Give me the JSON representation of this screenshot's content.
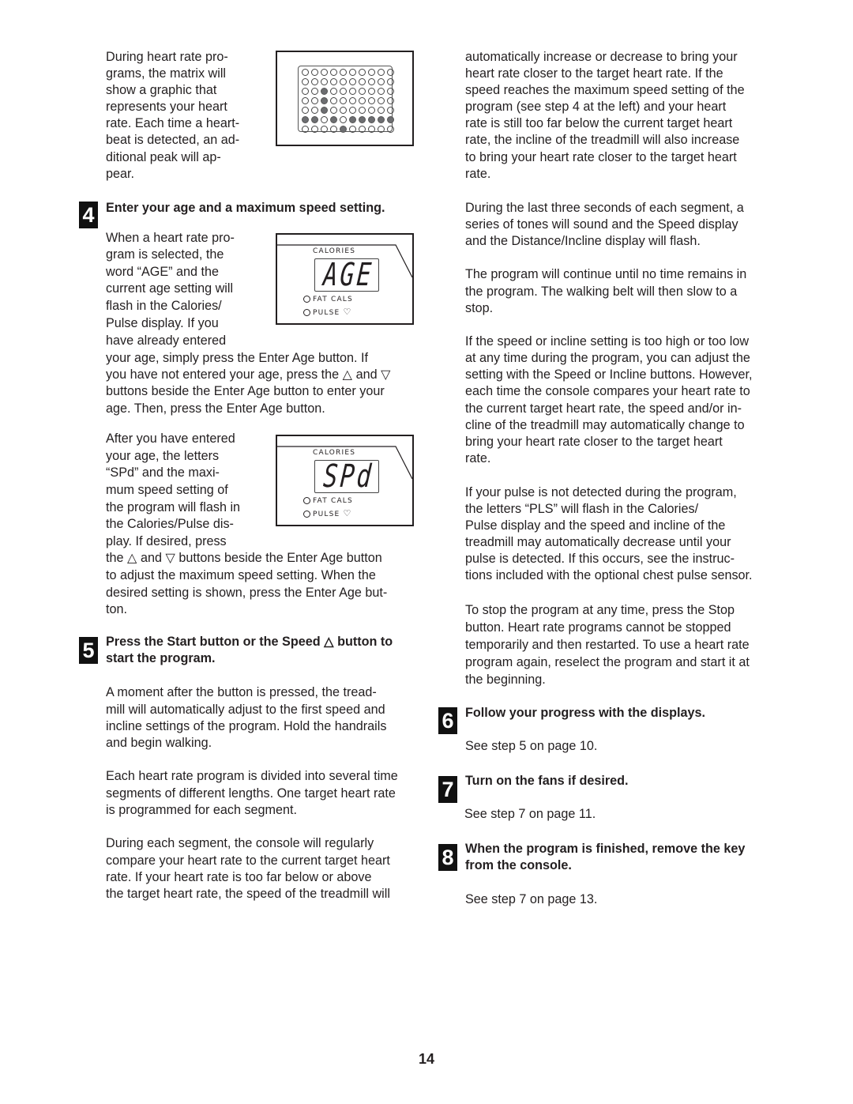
{
  "page_number": "14",
  "left_column": {
    "intro_lines": [
      "During heart rate pro-",
      "grams, the matrix will",
      "show a graphic that",
      "represents your heart",
      "rate. Each time a heart-",
      "beat is detected, an ad-",
      "ditional peak will ap-",
      "pear."
    ],
    "matrix_figure": {
      "columns": 10,
      "rows": [
        [
          0,
          0,
          0,
          0,
          0,
          0,
          0,
          0,
          0,
          0
        ],
        [
          0,
          0,
          0,
          0,
          0,
          0,
          0,
          0,
          0,
          0
        ],
        [
          0,
          0,
          1,
          0,
          0,
          0,
          0,
          0,
          0,
          0
        ],
        [
          0,
          0,
          1,
          0,
          0,
          0,
          0,
          0,
          0,
          0
        ],
        [
          0,
          0,
          1,
          0,
          0,
          0,
          0,
          0,
          0,
          0
        ],
        [
          1,
          1,
          0,
          1,
          0,
          1,
          1,
          1,
          1,
          1
        ],
        [
          0,
          0,
          0,
          0,
          1,
          0,
          0,
          0,
          0,
          0
        ]
      ]
    },
    "step4": {
      "number": "4",
      "heading": "Enter your age and a maximum speed setting.",
      "para1_lines": [
        "When a heart rate pro-",
        "gram is selected, the",
        "word “AGE” and the",
        "current age setting will",
        "flash in the Calories/",
        "Pulse display. If you",
        "have already entered",
        "your age, simply press the Enter Age button. If",
        "you have not entered your age, press the △ and ▽",
        "buttons beside the Enter Age button to enter your",
        "age. Then, press the Enter Age button."
      ],
      "para2_lines": [
        "After you have entered",
        "your age, the letters",
        "“SPd” and the maxi-",
        "mum speed setting of",
        "the program will flash in",
        "the Calories/Pulse dis-",
        "play. If desired, press",
        "the △ and ▽ buttons beside the Enter Age button",
        "to adjust the maximum speed setting. When the",
        "desired setting is shown, press the Enter Age but-",
        "ton."
      ],
      "display_age": {
        "label": "CALORIES",
        "lcd_text": "AGE",
        "indicator1": "FAT CALS",
        "indicator2": "PULSE",
        "heart_icon": "♡"
      },
      "display_spd": {
        "label": "CALORIES",
        "lcd_text": "SPd",
        "indicator1": "FAT CALS",
        "indicator2": "PULSE",
        "heart_icon": "♡"
      }
    },
    "step5": {
      "number": "5",
      "heading_lines": [
        "Press the Start button or the Speed △ button to",
        "start the program."
      ],
      "para1_lines": [
        "A moment after the button is pressed, the tread-",
        "mill will automatically adjust to the first speed and",
        "incline settings of the program. Hold the handrails",
        "and begin walking."
      ],
      "para2_lines": [
        "Each heart rate program is divided into several time",
        "segments of different lengths. One target heart rate",
        "is programmed for each segment."
      ],
      "para3_lines": [
        "During each segment, the console will regularly",
        "compare your heart rate to the current target heart",
        "rate. If your heart rate is too far below or above",
        "the target heart rate, the speed of the treadmill will"
      ]
    }
  },
  "right_column": {
    "para1_lines": [
      "automatically increase or decrease to bring your",
      "heart rate closer to the target heart rate. If the",
      "speed reaches the maximum speed setting of the",
      "program (see step 4 at the left) and your heart",
      "rate is still too far below the current target heart",
      "rate, the incline of the treadmill will also increase",
      "to bring your heart rate closer to the target heart",
      "rate."
    ],
    "para2_lines": [
      "During the last three seconds of each segment, a",
      "series of tones will sound and the Speed display",
      "and the Distance/Incline display will flash."
    ],
    "para3_lines": [
      "The program will continue until no time remains in",
      "the program. The walking belt will then slow to a",
      "stop."
    ],
    "para4_lines": [
      "If the speed or incline setting is too high or too low",
      "at any time during the program, you can adjust the",
      "setting with the Speed or Incline buttons. However,",
      "each time the console compares your heart rate to",
      "the current target heart rate, the speed and/or in-",
      "cline of the treadmill may automatically change to",
      "bring your heart rate closer to the target heart",
      "rate."
    ],
    "para5_lines": [
      "If your pulse is not detected during the program,",
      "the letters “PLS” will flash in the Calories/",
      "Pulse display and the speed and incline of the",
      "treadmill may automatically decrease until your",
      "pulse is detected. If this occurs, see the instruc-",
      "tions included with the optional chest pulse sensor."
    ],
    "para6_lines": [
      "To stop the program at any time, press the Stop",
      "button. Heart rate programs cannot be stopped",
      "temporarily and then restarted. To use a heart rate",
      "program again, reselect the program and start it at",
      "the beginning."
    ],
    "step6": {
      "number": "6",
      "heading": "Follow your progress with the displays.",
      "body": "See step 5 on page 10."
    },
    "step7": {
      "number": "7",
      "heading": "Turn on the fans if desired.",
      "body": "See step 7 on page 11."
    },
    "step8": {
      "number": "8",
      "heading_lines": [
        "When the program is finished, remove the key",
        "from the console."
      ],
      "body": "See step 7 on page 13."
    }
  }
}
